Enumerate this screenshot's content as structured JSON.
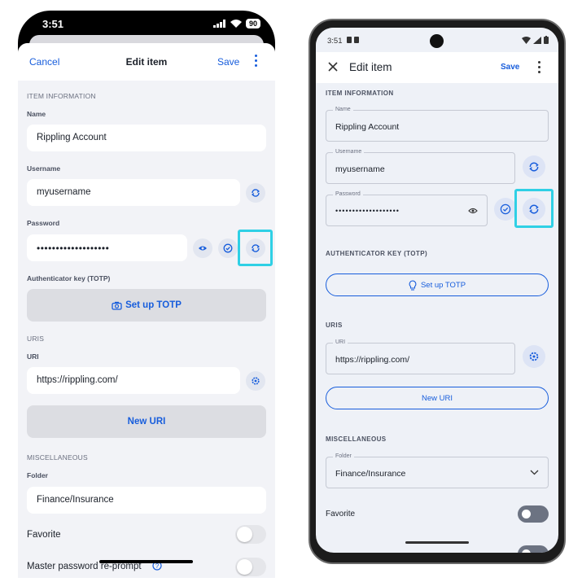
{
  "ios": {
    "status": {
      "time": "3:51",
      "battery": "90"
    },
    "nav": {
      "cancel": "Cancel",
      "title": "Edit item",
      "save": "Save"
    },
    "item_information": "ITEM INFORMATION",
    "name_label": "Name",
    "name_value": "Rippling Account",
    "username_label": "Username",
    "username_value": "myusername",
    "password_label": "Password",
    "password_value": "•••••••••••••••••••",
    "totp_label": "Authenticator key (TOTP)",
    "totp_button": "Set up TOTP",
    "uris_header": "URIS",
    "uri_label": "URI",
    "uri_value": "https://rippling.com/",
    "new_uri_button": "New URI",
    "misc_header": "MISCELLANEOUS",
    "folder_label": "Folder",
    "folder_value": "Finance/Insurance",
    "favorite_label": "Favorite",
    "favorite_on": false,
    "reprompt_label": "Master password re-prompt"
  },
  "android": {
    "status": {
      "time": "3:51"
    },
    "appbar": {
      "title": "Edit item",
      "save": "Save"
    },
    "item_information": "ITEM INFORMATION",
    "name_label": "Name",
    "name_value": "Rippling Account",
    "username_label": "Username",
    "username_value": "myusername",
    "password_label": "Password",
    "password_value": "•••••••••••••••••••",
    "totp_header": "AUTHENTICATOR KEY (TOTP)",
    "totp_button": "Set up TOTP",
    "uris_header": "URIS",
    "uri_label": "URI",
    "uri_value": "https://rippling.com/",
    "new_uri_button": "New URI",
    "misc_header": "MISCELLANEOUS",
    "folder_label": "Folder",
    "folder_value": "Finance/Insurance",
    "favorite_label": "Favorite",
    "favorite_on": false
  },
  "colors": {
    "accent": "#175ddc",
    "highlight": "#2fd0e5",
    "ios_background": "#f2f3f7",
    "android_background": "#eef1f7"
  }
}
